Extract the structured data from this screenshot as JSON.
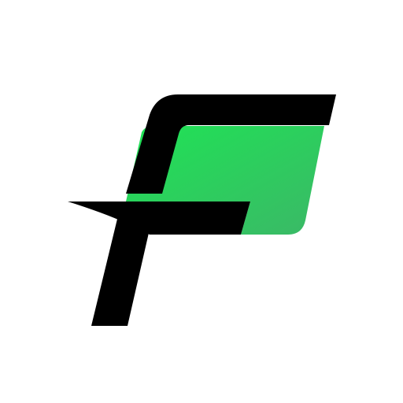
{
  "logo": {
    "icon": "stylized-f-lettermark",
    "colors": {
      "background": "#ffffff",
      "primary_black": "#000000",
      "green_light": "#1fe355",
      "green_dark": "#3bb867"
    }
  }
}
